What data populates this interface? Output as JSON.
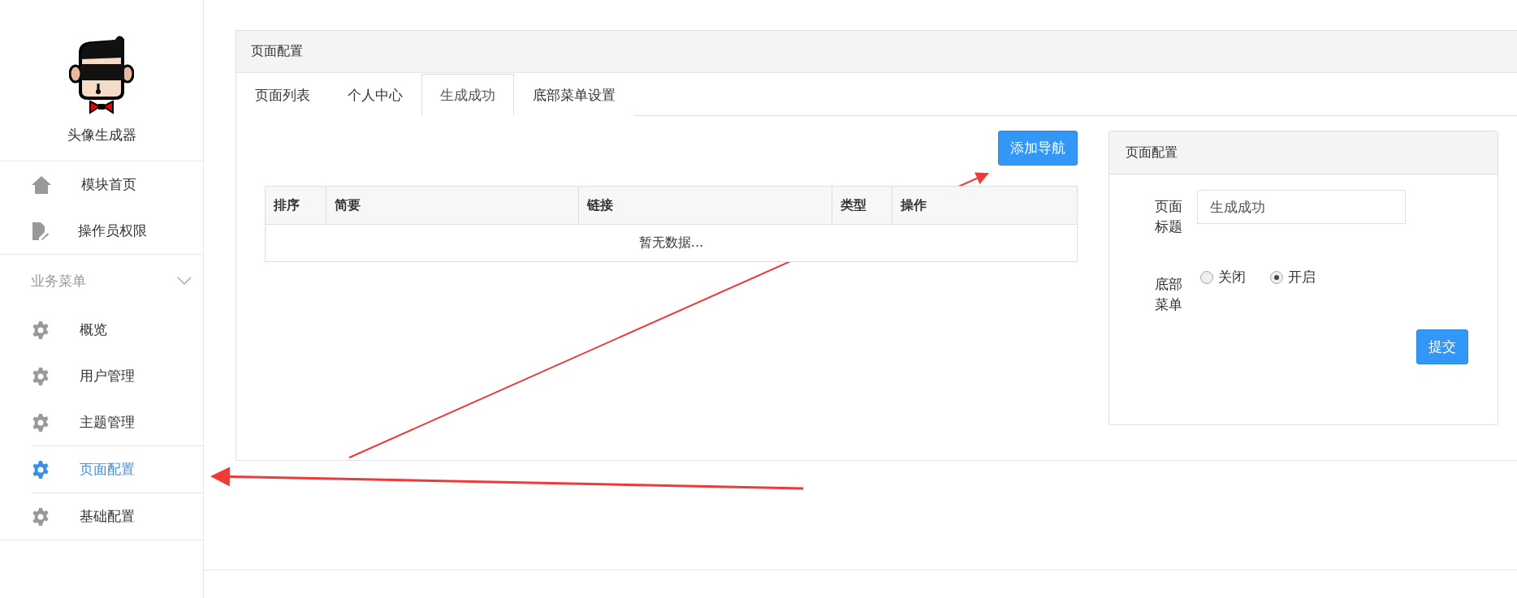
{
  "sidebar": {
    "app_name": "头像生成器",
    "items": [
      {
        "label": "模块首页",
        "kind": "home",
        "selected": false
      },
      {
        "label": "操作员权限",
        "kind": "document",
        "selected": false
      }
    ],
    "section": {
      "title": "业务菜单",
      "expanded": true,
      "items": [
        {
          "label": "概览",
          "kind": "gear",
          "selected": false
        },
        {
          "label": "用户管理",
          "kind": "gear",
          "selected": false
        },
        {
          "label": "主题管理",
          "kind": "gear",
          "selected": false
        },
        {
          "label": "页面配置",
          "kind": "gear",
          "selected": true
        },
        {
          "label": "基础配置",
          "kind": "gear",
          "selected": false
        }
      ]
    }
  },
  "panel": {
    "title": "页面配置",
    "tabs": [
      {
        "label": "页面列表",
        "selected": false
      },
      {
        "label": "个人中心",
        "selected": false
      },
      {
        "label": "生成成功",
        "selected": true
      },
      {
        "label": "底部菜单设置",
        "selected": false
      }
    ],
    "add_button": "添加导航",
    "table": {
      "columns": [
        "排序",
        "简要",
        "链接",
        "类型",
        "操作"
      ],
      "empty_text": "暂无数据..."
    },
    "form": {
      "title": "页面配置",
      "page_title_label": "页面标题",
      "page_title_value": "生成成功",
      "bottom_menu_label": "底部菜单",
      "options": [
        {
          "label": "关闭",
          "selected": false
        },
        {
          "label": "开启",
          "selected": true
        }
      ],
      "submit": "提交"
    }
  }
}
